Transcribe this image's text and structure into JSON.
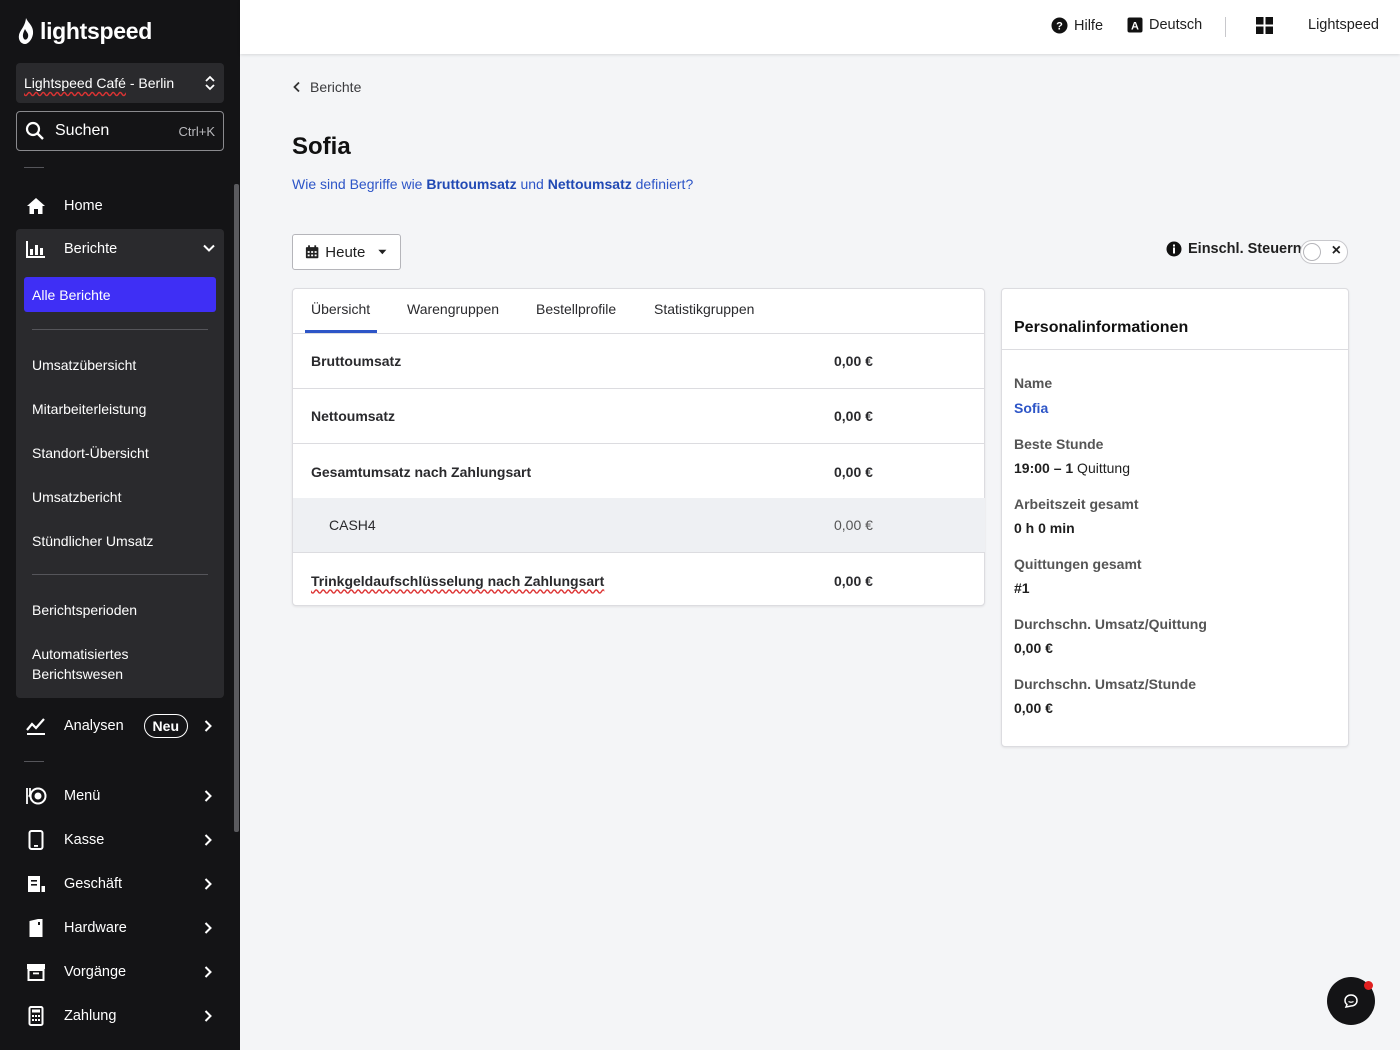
{
  "brand": {
    "name": "lightspeed"
  },
  "sidebar": {
    "store": "Lightspeed Café - Berlin",
    "search": {
      "placeholder": "Suchen",
      "shortcut": "Ctrl+K"
    },
    "home": "Home",
    "reports": {
      "label": "Berichte",
      "active": "Alle Berichte",
      "group1": [
        "Umsatzübersicht",
        "Mitarbeiterleistung",
        "Standort-Übersicht",
        "Umsatzbericht",
        "Stündlicher Umsatz"
      ],
      "group2": [
        "Berichtsperioden",
        "Automatisiertes Berichtswesen"
      ]
    },
    "analysen": {
      "label": "Analysen",
      "badge": "Neu"
    },
    "items": [
      {
        "label": "Menü",
        "icon": "menu-plate-icon"
      },
      {
        "label": "Kasse",
        "icon": "tablet-icon"
      },
      {
        "label": "Geschäft",
        "icon": "business-icon"
      },
      {
        "label": "Hardware",
        "icon": "hardware-icon"
      },
      {
        "label": "Vorgänge",
        "icon": "archive-icon"
      },
      {
        "label": "Zahlung",
        "icon": "calculator-icon"
      }
    ]
  },
  "topbar": {
    "help": "Hilfe",
    "language": "Deutsch",
    "account": "Lightspeed"
  },
  "breadcrumb": "Berichte",
  "page": {
    "title": "Sofia",
    "help_prefix": "Wie sind Begriffe wie ",
    "help_term1": "Bruttoumsatz",
    "help_mid": " und ",
    "help_term2": "Nettoumsatz",
    "help_suffix": " definiert?"
  },
  "controls": {
    "period": "Heute",
    "tax_label": "Einschl. Steuern",
    "tax_included": false
  },
  "tabs": [
    "Übersicht",
    "Warengruppen",
    "Bestellprofile",
    "Statistikgruppen"
  ],
  "summary": {
    "rows": [
      {
        "label": "Bruttoumsatz",
        "value": "0,00 €"
      },
      {
        "label": "Nettoumsatz",
        "value": "0,00 €"
      },
      {
        "label": "Gesamtumsatz nach Zahlungsart",
        "value": "0,00 €"
      },
      {
        "label": "CASH4",
        "value": "0,00 €"
      },
      {
        "label": "Trinkgeldaufschlüsselung nach Zahlungsart",
        "value": "0,00 €"
      }
    ]
  },
  "personal": {
    "title": "Personalinformationen",
    "name_label": "Name",
    "name_value": "Sofia",
    "best_hour_label": "Beste Stunde",
    "best_hour_value": "19:00 – 1",
    "best_hour_unit": " Quittung",
    "worktime_label": "Arbeitszeit gesamt",
    "worktime_value": "0 h 0 min",
    "receipts_label": "Quittungen gesamt",
    "receipts_value": "#1",
    "avg_receipt_label": "Durchschn. Umsatz/Quittung",
    "avg_receipt_value": "0,00 €",
    "avg_hour_label": "Durchschn. Umsatz/Stunde",
    "avg_hour_value": "0,00 €"
  },
  "colors": {
    "accent": "#3f2ff5",
    "link": "#2d55c7",
    "sidebar_bg": "#141416",
    "notification": "#e02020"
  }
}
